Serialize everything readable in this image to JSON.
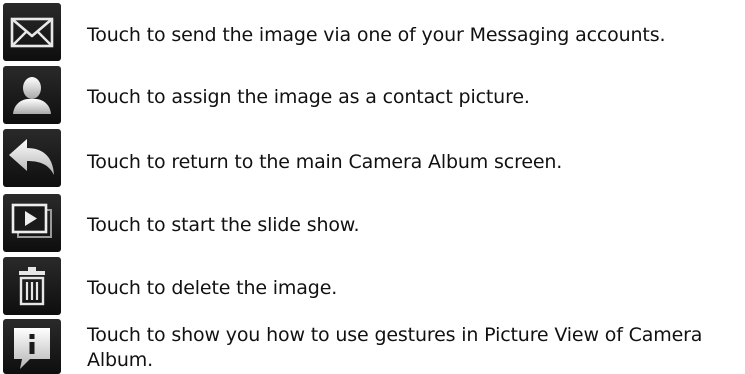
{
  "rows": [
    {
      "icon": "envelope-icon",
      "text": "Touch to send the image via one of your Messaging accounts."
    },
    {
      "icon": "contact-person-icon",
      "text": "Touch to assign the image as a contact picture."
    },
    {
      "icon": "back-arrow-icon",
      "text": "Touch to return to the main Camera Album screen."
    },
    {
      "icon": "slideshow-icon",
      "text": "Touch to start the slide show."
    },
    {
      "icon": "trash-icon",
      "text": "Touch to delete the image."
    },
    {
      "icon": "info-icon",
      "text": "Touch to show you how to use gestures in Picture View of Camera Album."
    }
  ]
}
